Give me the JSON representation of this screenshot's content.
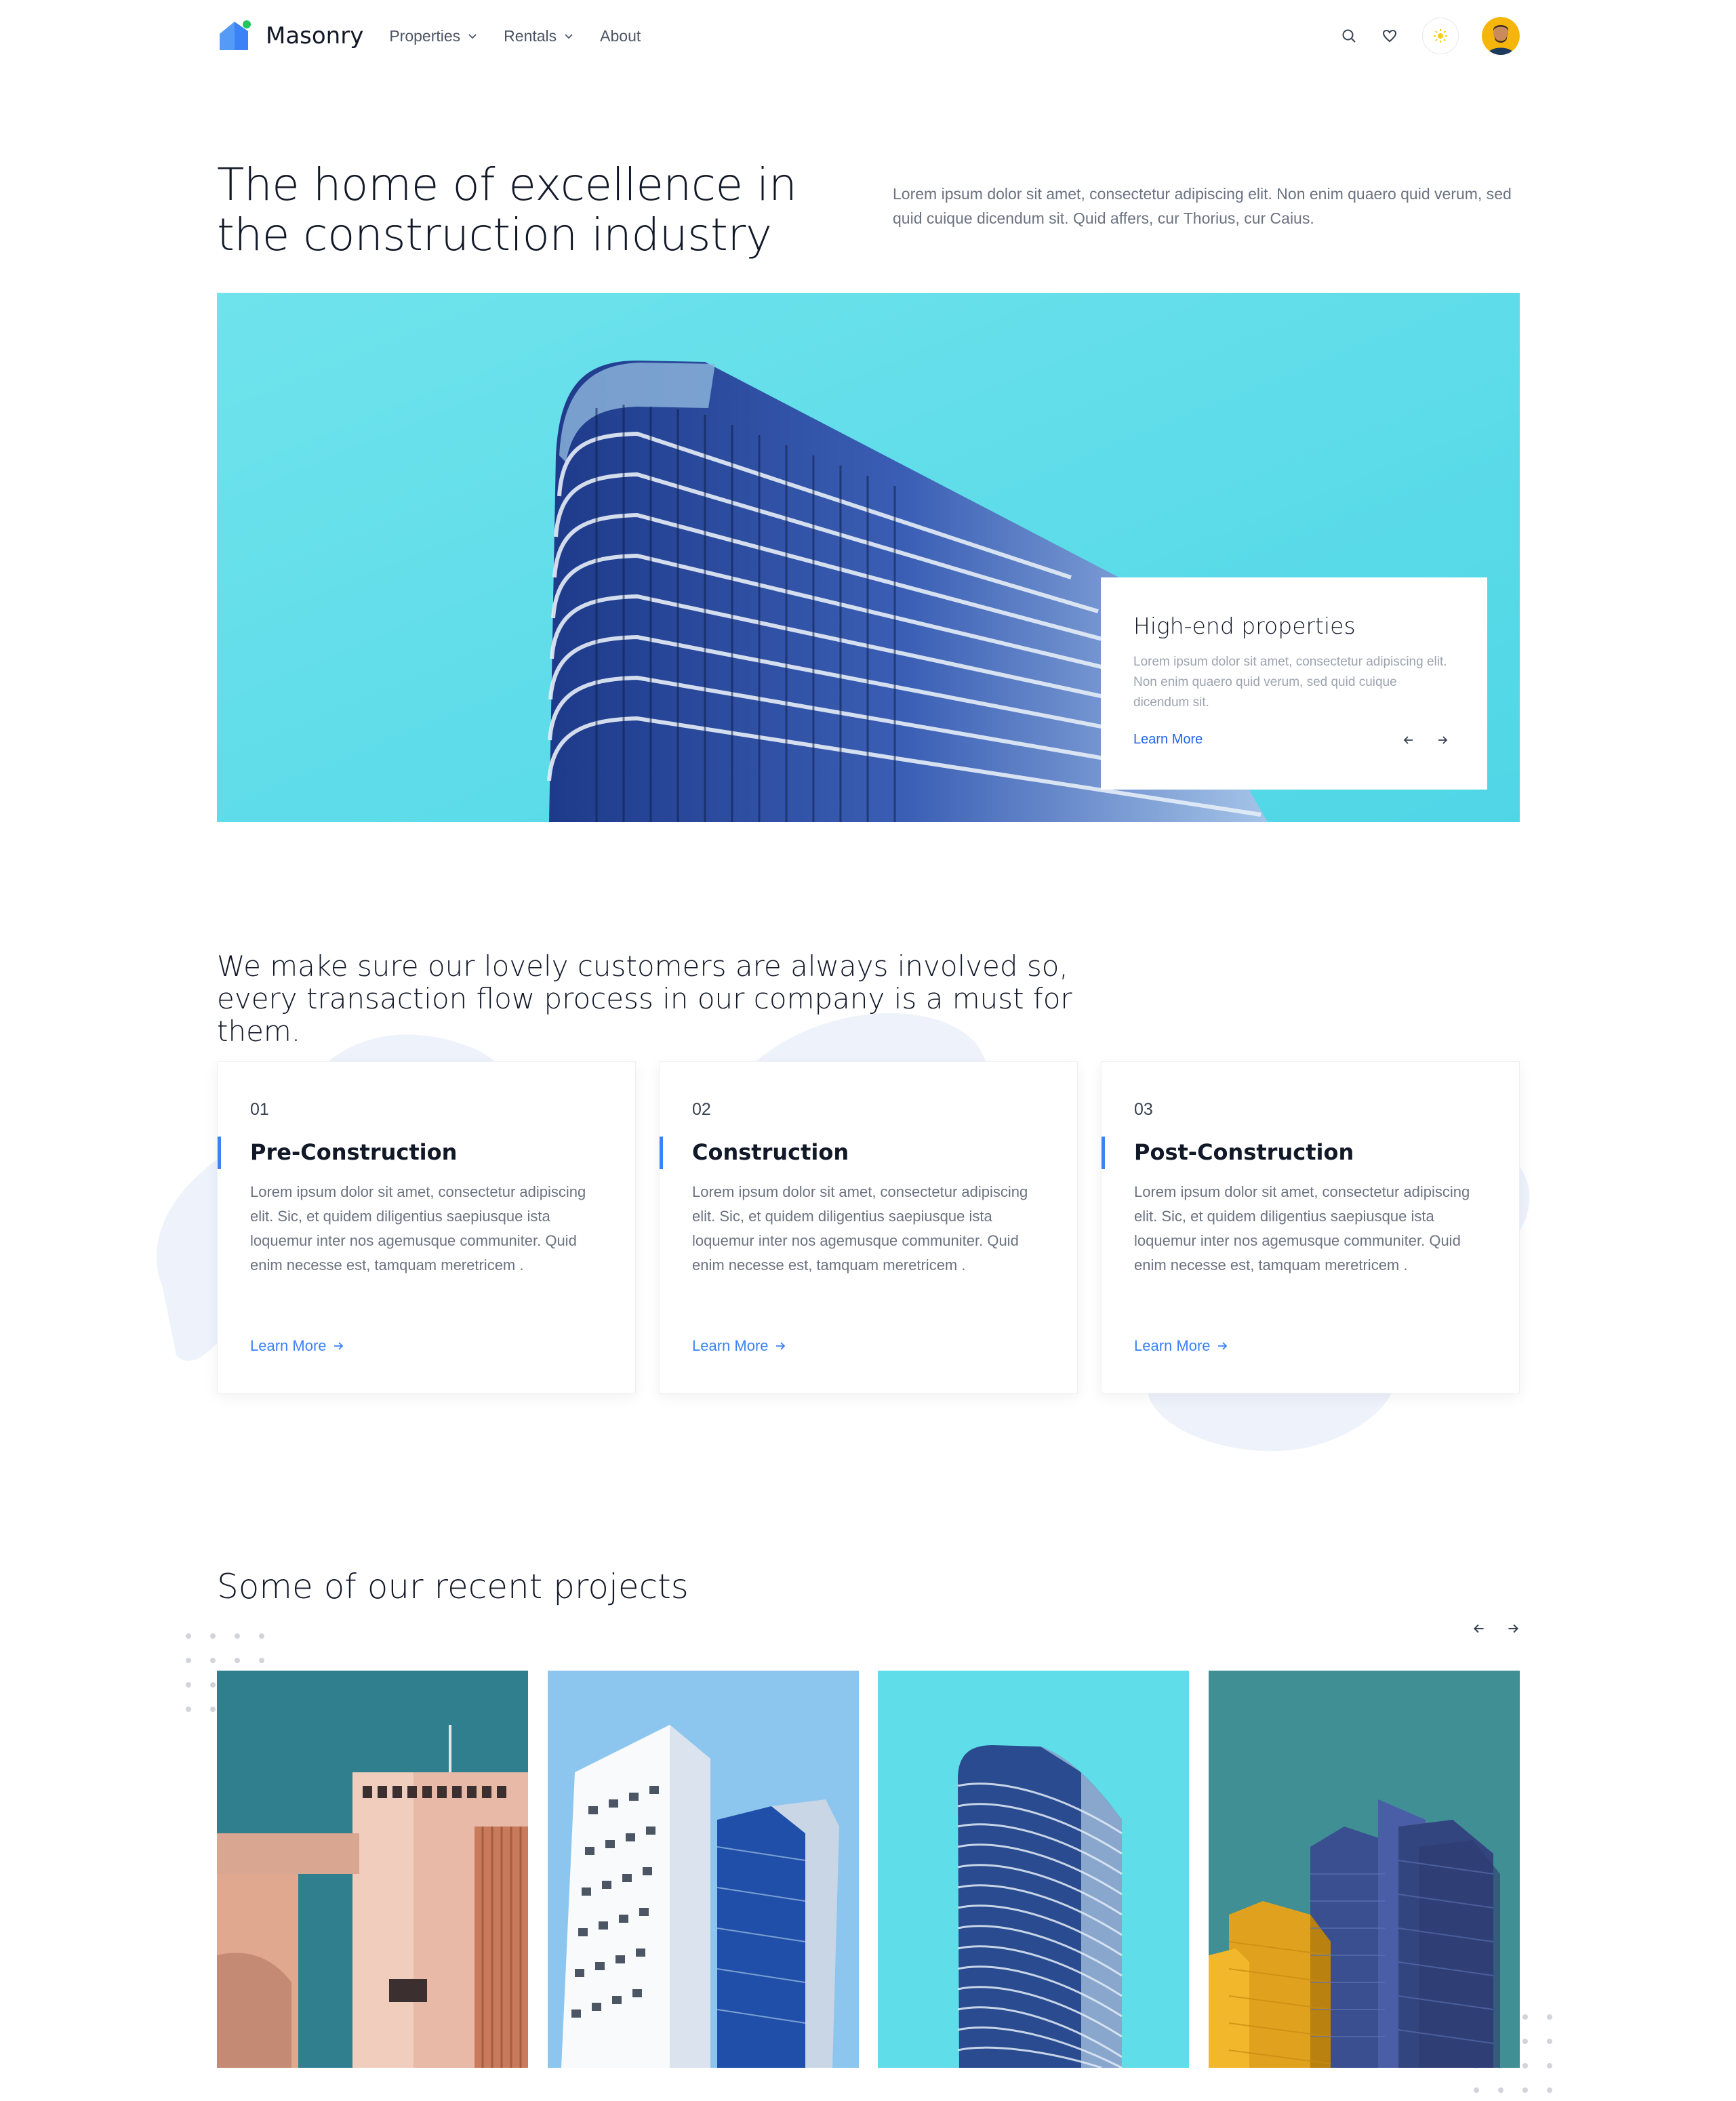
{
  "nav": {
    "logo_text": "Masonry",
    "menu": [
      {
        "label": "Properties",
        "has_dropdown": true
      },
      {
        "label": "Rentals",
        "has_dropdown": true
      },
      {
        "label": "About",
        "has_dropdown": false
      }
    ],
    "icons": [
      "search-icon",
      "heart-icon",
      "sun-icon",
      "avatar"
    ]
  },
  "hero": {
    "title": "The home of excellence in the construction industry",
    "subtitle": "Lorem ipsum dolor sit amet, consectetur adipiscing elit. Non enim quaero quid verum, sed quid cuique dicendum sit. Quid affers, cur Thorius, cur Caius.",
    "card": {
      "title": "High-end properties",
      "text": "Lorem ipsum dolor sit amet, consectetur adipiscing elit. Non enim quaero quid verum, sed quid cuique dicendum sit.",
      "link": "Learn More"
    }
  },
  "process": {
    "title": "We make sure our lovely customers are always involved so, every transaction flow process in our company is a must for them.",
    "cards": [
      {
        "num": "01",
        "title": "Pre-Construction",
        "text": "Lorem ipsum dolor sit amet, consectetur adipiscing elit. Sic, et quidem diligentius saepiusque ista loquemur inter nos agemusque communiter. Quid enim necesse est, tamquam meretricem .",
        "link": "Learn More"
      },
      {
        "num": "02",
        "title": "Construction",
        "text": "Lorem ipsum dolor sit amet, consectetur adipiscing elit. Sic, et quidem diligentius saepiusque ista loquemur inter nos agemusque communiter. Quid enim necesse est, tamquam meretricem .",
        "link": "Learn More"
      },
      {
        "num": "03",
        "title": "Post-Construction",
        "text": "Lorem ipsum dolor sit amet, consectetur adipiscing elit. Sic, et quidem diligentius saepiusque ista loquemur inter nos agemusque communiter. Quid enim necesse est, tamquam meretricem .",
        "link": "Learn More"
      }
    ]
  },
  "projects": {
    "title": "Some of our recent projects"
  },
  "colors": {
    "accent": "#3b82f6",
    "link": "#2563eb",
    "sky": "#5fdde8",
    "text_dark": "#111827",
    "text_muted": "#6b7280"
  }
}
